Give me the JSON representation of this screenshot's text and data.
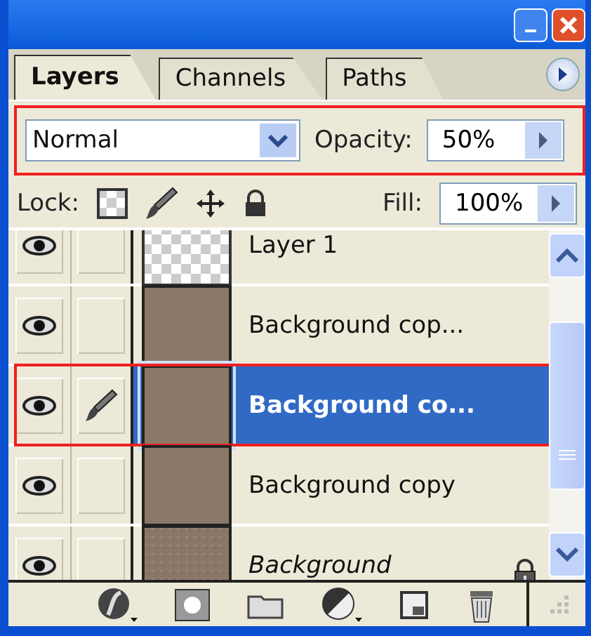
{
  "tabs": [
    {
      "label": "Layers",
      "selected": true
    },
    {
      "label": "Channels",
      "selected": false
    },
    {
      "label": "Paths",
      "selected": false
    }
  ],
  "blend_mode": {
    "value": "Normal"
  },
  "opacity": {
    "label": "Opacity:",
    "value": "50%"
  },
  "lock": {
    "label": "Lock:"
  },
  "fill": {
    "label": "Fill:",
    "value": "100%"
  },
  "layers": [
    {
      "name": "Layer 1",
      "kind": "transparent",
      "visible": true,
      "paint_target": false,
      "selected": false,
      "locked": false
    },
    {
      "name": "Background cop...",
      "kind": "fill",
      "visible": true,
      "paint_target": false,
      "selected": false,
      "locked": false
    },
    {
      "name": "Background co...",
      "kind": "fill",
      "visible": true,
      "paint_target": true,
      "selected": true,
      "locked": false
    },
    {
      "name": "Background copy",
      "kind": "fill",
      "visible": true,
      "paint_target": false,
      "selected": false,
      "locked": false
    },
    {
      "name": "Background",
      "kind": "background",
      "visible": true,
      "paint_target": false,
      "selected": false,
      "locked": true
    }
  ]
}
